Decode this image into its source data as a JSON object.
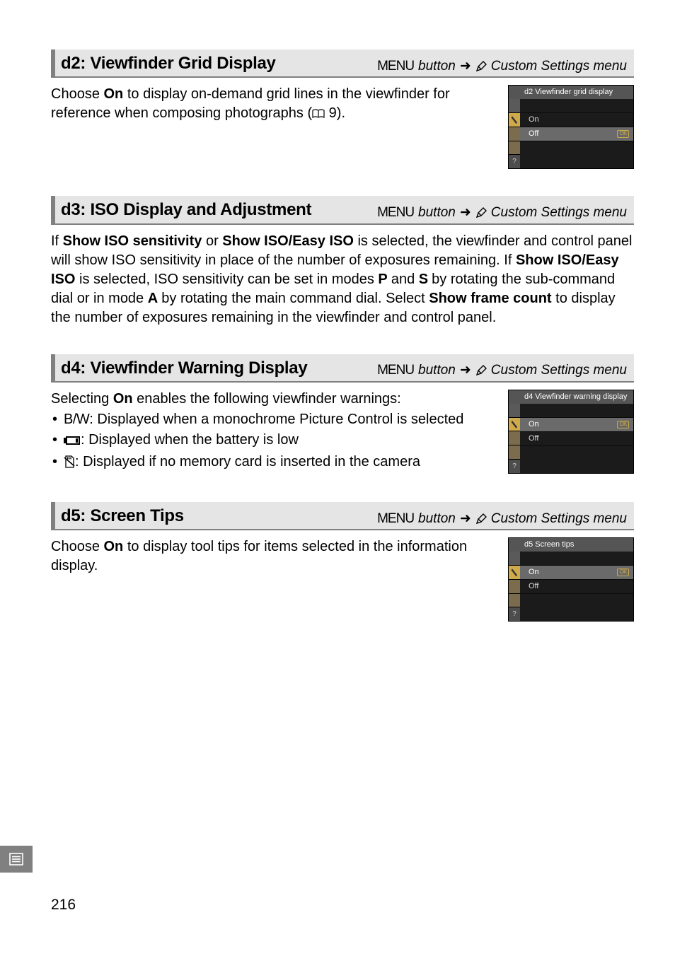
{
  "sections": {
    "d2": {
      "title": "d2: Viewfinder Grid Display",
      "nav_menu_word": "MENU",
      "nav_button": "button",
      "nav_right": "Custom Settings menu",
      "body_a": "Choose ",
      "body_b": "On",
      "body_c": " to display on-demand grid lines in the viewfinder for reference when composing photographs (",
      "body_d": " 9).",
      "shot": {
        "title": "d2 Viewfinder grid display",
        "on": "On",
        "off": "Off",
        "ok": "OK",
        "q": "?"
      }
    },
    "d3": {
      "title": "d3: ISO Display and Adjustment",
      "nav_menu_word": "MENU",
      "nav_button": "button",
      "nav_right": "Custom Settings menu",
      "p1_a": "If ",
      "p1_b": "Show ISO sensitivity",
      "p1_c": " or ",
      "p1_d": "Show ISO/Easy ISO",
      "p1_e": " is selected, the viewfinder and control panel will show ISO sensitivity in place of the number of exposures remaining.  If ",
      "p1_f": "Show ISO/Easy ISO",
      "p1_g": " is selected, ISO sensitivity can be set in modes ",
      "p1_h": "P",
      "p1_i": " and ",
      "p1_j": "S",
      "p1_k": " by rotating the sub-command dial or in mode ",
      "p1_l": "A",
      "p1_m": " by rotating the main command dial.  Select ",
      "p1_n": "Show frame count",
      "p1_o": " to display the number of exposures remaining in the viewfinder and control panel."
    },
    "d4": {
      "title": "d4: Viewfinder Warning Display",
      "nav_menu_word": "MENU",
      "nav_button": "button",
      "nav_right": "Custom Settings menu",
      "lead_a": "Selecting ",
      "lead_b": "On",
      "lead_c": " enables the following viewfinder warnings:",
      "li1_sym": "B/W",
      "li1_txt": ": Displayed when a monochrome Picture Control is selected",
      "li2_txt": ": Displayed when the battery is low",
      "li3_txt": ": Displayed if no memory card is inserted in the camera",
      "shot": {
        "title": "d4 Viewfinder warning display",
        "on": "On",
        "off": "Off",
        "ok": "OK",
        "q": "?"
      }
    },
    "d5": {
      "title": "d5: Screen Tips",
      "nav_menu_word": "MENU",
      "nav_button": "button",
      "nav_right": "Custom Settings menu",
      "body_a": "Choose ",
      "body_b": "On",
      "body_c": " to display tool tips for items selected in the information display.",
      "shot": {
        "title": "d5 Screen tips",
        "on": "On",
        "off": "Off",
        "ok": "OK",
        "q": "?"
      }
    }
  },
  "page_number": "216"
}
